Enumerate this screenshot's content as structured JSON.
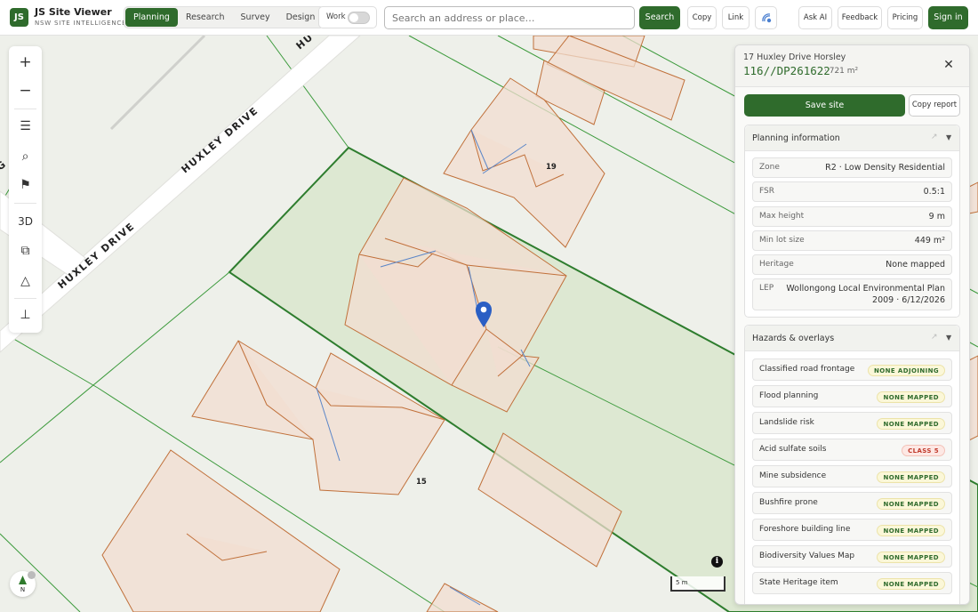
{
  "brand": {
    "logo": "JS",
    "title": "JS Site Viewer",
    "subtitle": "NSW SITE INTELLIGENCE"
  },
  "tabs": [
    {
      "label": "Planning",
      "active": true
    },
    {
      "label": "Research",
      "active": false
    },
    {
      "label": "Survey",
      "active": false
    },
    {
      "label": "Design",
      "active": false
    }
  ],
  "work_toggle": {
    "label": "Work",
    "on": false
  },
  "search": {
    "placeholder": "Search an address or place…",
    "button": "Search"
  },
  "toolbar": {
    "copy": "Copy",
    "link": "Link",
    "ask_ai": "Ask AI",
    "feedback": "Feedback",
    "pricing": "Pricing",
    "sign_in": "Sign in"
  },
  "map_tools": {
    "zoom_in": "+",
    "zoom_out": "−",
    "layers": "☰",
    "search": "⌕",
    "flag": "⚑",
    "three_d": "3D",
    "copy": "⧉",
    "measure": "△",
    "depth": "⊥"
  },
  "map": {
    "street_labels": [
      "HUXLEY DRIVE",
      "HUXLEY DRIVE",
      "HU",
      "G"
    ],
    "house_numbers": [
      "19",
      "15"
    ],
    "scale": "5 m",
    "compass": "N",
    "colors": {
      "background": "#eef0ea",
      "road": "#ffffff",
      "parcel_line": "#2e8b2e",
      "selected_fill": "#dde8d2",
      "roof_fill": "#f1ddd0",
      "roof_line": "#c0703a",
      "marker": "#2b5fc4"
    }
  },
  "panel": {
    "address": "17 Huxley Drive Horsley",
    "lot": "116//DP261622",
    "area": "· 721 m²",
    "close": "✕",
    "save_button": "Save site",
    "copy_report_button": "Copy report",
    "planning": {
      "title": "Planning information",
      "rows": [
        {
          "key": "Zone",
          "value": "R2 · Low Density Residential"
        },
        {
          "key": "FSR",
          "value": "0.5:1"
        },
        {
          "key": "Max height",
          "value": "9 m"
        },
        {
          "key": "Min lot size",
          "value": "449 m²"
        },
        {
          "key": "Heritage",
          "value": "None mapped"
        },
        {
          "key": "LEP",
          "value_line1": "Wollongong Local Environmental Plan",
          "value_line2": "2009 · 6/12/2026"
        }
      ]
    },
    "hazards": {
      "title": "Hazards & overlays",
      "rows": [
        {
          "key": "Classified road frontage",
          "badge": "NONE ADJOINING",
          "kind": "none"
        },
        {
          "key": "Flood planning",
          "badge": "NONE MAPPED",
          "kind": "none"
        },
        {
          "key": "Landslide risk",
          "badge": "NONE MAPPED",
          "kind": "none"
        },
        {
          "key": "Acid sulfate soils",
          "badge": "CLASS 5",
          "kind": "class"
        },
        {
          "key": "Mine subsidence",
          "badge": "NONE MAPPED",
          "kind": "none"
        },
        {
          "key": "Bushfire prone",
          "badge": "NONE MAPPED",
          "kind": "none"
        },
        {
          "key": "Foreshore building line",
          "badge": "NONE MAPPED",
          "kind": "none"
        },
        {
          "key": "Biodiversity Values Map",
          "badge": "NONE MAPPED",
          "kind": "none"
        },
        {
          "key": "State Heritage item",
          "badge": "NONE MAPPED",
          "kind": "none"
        }
      ]
    }
  }
}
